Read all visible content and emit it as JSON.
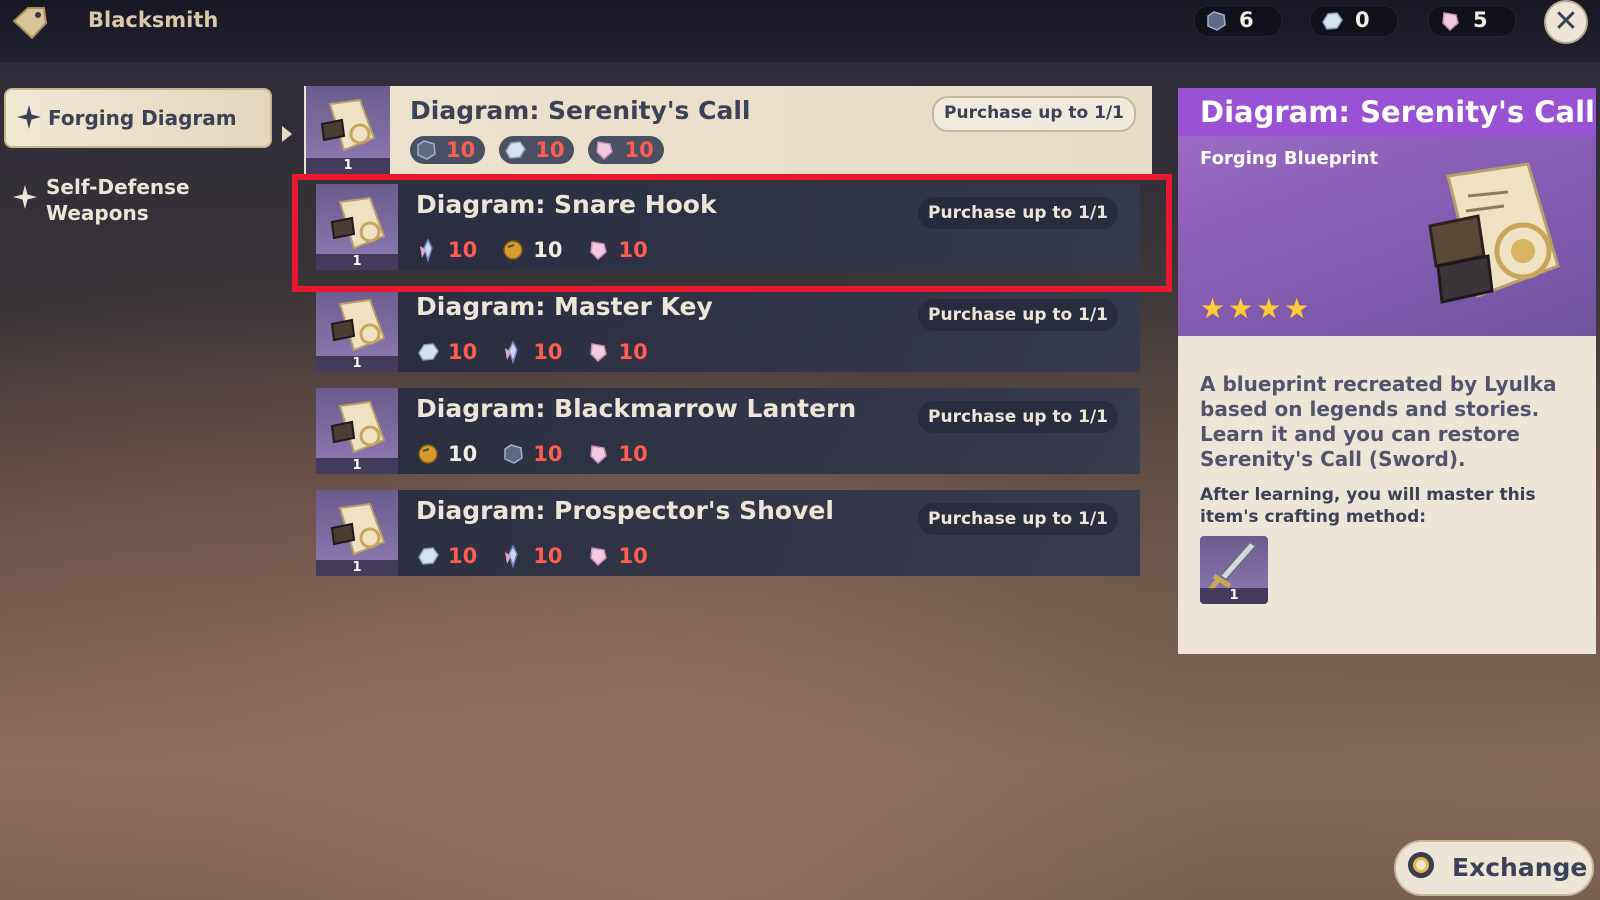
{
  "header": {
    "title": "Blacksmith",
    "shop_icon": "price-tag-icon",
    "currencies": [
      {
        "icon": "ore-dark-icon",
        "value": "6"
      },
      {
        "icon": "ore-silver-icon",
        "value": "0"
      },
      {
        "icon": "crystal-pink-icon",
        "value": "5"
      }
    ],
    "close_icon": "close-icon"
  },
  "sidebar": {
    "items": [
      {
        "label": "Forging Diagram",
        "active": true
      },
      {
        "label": "Self-Defense Weapons",
        "active": false
      }
    ]
  },
  "list": {
    "items": [
      {
        "title": "Diagram: Serenity's Call",
        "limit": "Purchase up to 1/1",
        "qty": "1",
        "costs": [
          {
            "icon": "ore-dark-icon",
            "value": "10",
            "insufficient": true
          },
          {
            "icon": "ore-silver-icon",
            "value": "10",
            "insufficient": true
          },
          {
            "icon": "crystal-pink-icon",
            "value": "10",
            "insufficient": true
          }
        ]
      },
      {
        "title": "Diagram: Snare Hook",
        "limit": "Purchase up to 1/1",
        "qty": "1",
        "costs": [
          {
            "icon": "crystal-blue-icon",
            "value": "10",
            "insufficient": true
          },
          {
            "icon": "ore-amber-icon",
            "value": "10",
            "insufficient": false
          },
          {
            "icon": "crystal-pink-icon",
            "value": "10",
            "insufficient": true
          }
        ]
      },
      {
        "title": "Diagram: Master Key",
        "limit": "Purchase up to 1/1",
        "qty": "1",
        "costs": [
          {
            "icon": "ore-silver-icon",
            "value": "10",
            "insufficient": true
          },
          {
            "icon": "crystal-blue-icon",
            "value": "10",
            "insufficient": true
          },
          {
            "icon": "crystal-pink-icon",
            "value": "10",
            "insufficient": true
          }
        ]
      },
      {
        "title": "Diagram: Blackmarrow Lantern",
        "limit": "Purchase up to 1/1",
        "qty": "1",
        "costs": [
          {
            "icon": "ore-amber-icon",
            "value": "10",
            "insufficient": false
          },
          {
            "icon": "ore-dark-icon",
            "value": "10",
            "insufficient": true
          },
          {
            "icon": "crystal-pink-icon",
            "value": "10",
            "insufficient": true
          }
        ]
      },
      {
        "title": "Diagram: Prospector's Shovel",
        "limit": "Purchase up to 1/1",
        "qty": "1",
        "costs": [
          {
            "icon": "ore-silver-icon",
            "value": "10",
            "insufficient": true
          },
          {
            "icon": "crystal-blue-icon",
            "value": "10",
            "insufficient": true
          },
          {
            "icon": "crystal-pink-icon",
            "value": "10",
            "insufficient": true
          }
        ]
      }
    ],
    "highlighted_index": 1
  },
  "detail": {
    "title": "Diagram: Serenity's Call",
    "type": "Forging Blueprint",
    "stars": "★★★★",
    "rarity": 4,
    "description": "A blueprint recreated by Lyulka based on legends and stories. Learn it and you can restore Serenity's Call (Sword).",
    "learn_text": "After learning, you will master this item's crafting method:",
    "result_qty": "1",
    "result_icon": "sword-icon"
  },
  "footer": {
    "exchange_label": "Exchange",
    "exchange_icon": "controller-button-icon"
  },
  "colors": {
    "insufficient": "#ff5d50",
    "highlight": "#e8192f",
    "detail_header": "#9a52d4",
    "stars": "#ffcc33"
  }
}
